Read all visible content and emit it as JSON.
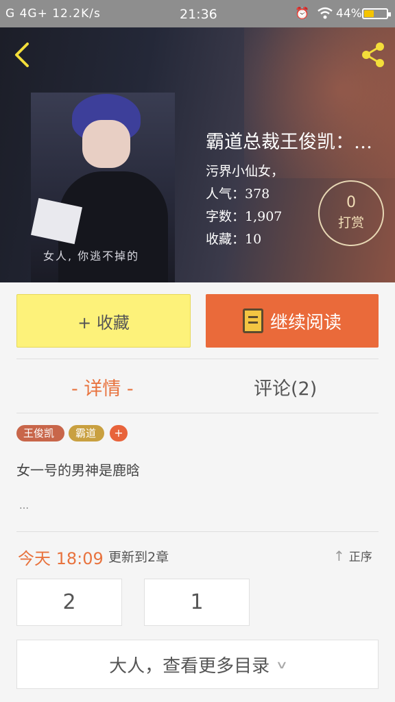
{
  "status_bar": {
    "left": "G 4G+ 12.2K/s",
    "time": "21:36",
    "battery_text": "44%",
    "battery_level": 0.44
  },
  "header": {
    "back_icon": "chevron-left-icon",
    "share_icon": "share-icon"
  },
  "book": {
    "cover_caption": "女人, 你逃不掉的",
    "title": "霸道总裁王俊凯：…",
    "author": "污界小仙女，",
    "popularity": "人气：378",
    "word_count": "字数：1,907",
    "favorites": "收藏：10",
    "tip_count": "0",
    "tip_label": "打赏"
  },
  "actions": {
    "favorite_label": "+ 收藏",
    "read_label": "继续阅读"
  },
  "tabs": [
    {
      "label": "- 详情 -",
      "active": true
    },
    {
      "label": "评论(2)",
      "active": false
    }
  ],
  "tags": [
    "王俊凯",
    "霸道",
    "+"
  ],
  "description": "女一号的男神是鹿晗",
  "description_more": "…",
  "update": {
    "time": "今天 18:09",
    "text": "更新到2章",
    "sort_label": "正序"
  },
  "chapters": [
    "2",
    "1"
  ],
  "more_toc_label": "大人，查看更多目录",
  "colors": {
    "accent": "#e8733e",
    "favorite_button": "#fdf27a",
    "read_button": "#ea6a3a"
  }
}
